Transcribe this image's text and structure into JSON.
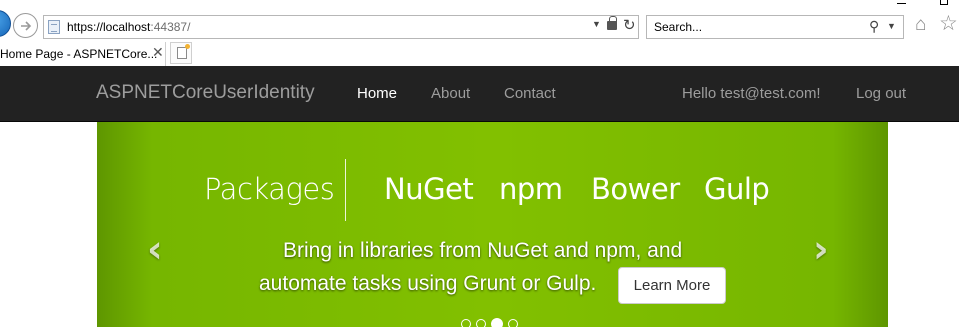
{
  "browser": {
    "address": {
      "base": "https://localhost",
      "port": ":44387/"
    },
    "search": {
      "placeholder": "Search..."
    },
    "tab": {
      "title": "Home Page - ASPNETCore...",
      "close": "✕"
    },
    "icons": {
      "back": "back-arrow-icon",
      "forward": "forward-arrow-icon",
      "page": "page-icon",
      "lock": "lock-icon",
      "refresh": "refresh-icon",
      "search": "search-icon",
      "home": "home-icon",
      "favorites": "favorites-star-icon",
      "new_tab": "new-tab-icon"
    }
  },
  "navbar": {
    "brand": "ASPNETCoreUserIdentity",
    "items": [
      {
        "label": "Home",
        "active": true
      },
      {
        "label": "About",
        "active": false
      },
      {
        "label": "Contact",
        "active": false
      }
    ],
    "greeting": "Hello test@test.com!",
    "logout": "Log out"
  },
  "carousel": {
    "heading": "Packages",
    "packages": [
      "NuGet",
      "npm",
      "Bower",
      "Gulp"
    ],
    "caption_line1": "Bring in libraries from NuGet and npm, and",
    "caption_line2": "automate tasks using Grunt or Gulp.",
    "button": "Learn More",
    "prev_arrow": "‹",
    "next_arrow": "›",
    "slide_count": 4,
    "active_slide": 3
  },
  "colors": {
    "navbar_bg": "#222222",
    "nav_text": "#9d9d9d",
    "nav_active": "#ffffff",
    "carousel_green": "#82c000"
  }
}
